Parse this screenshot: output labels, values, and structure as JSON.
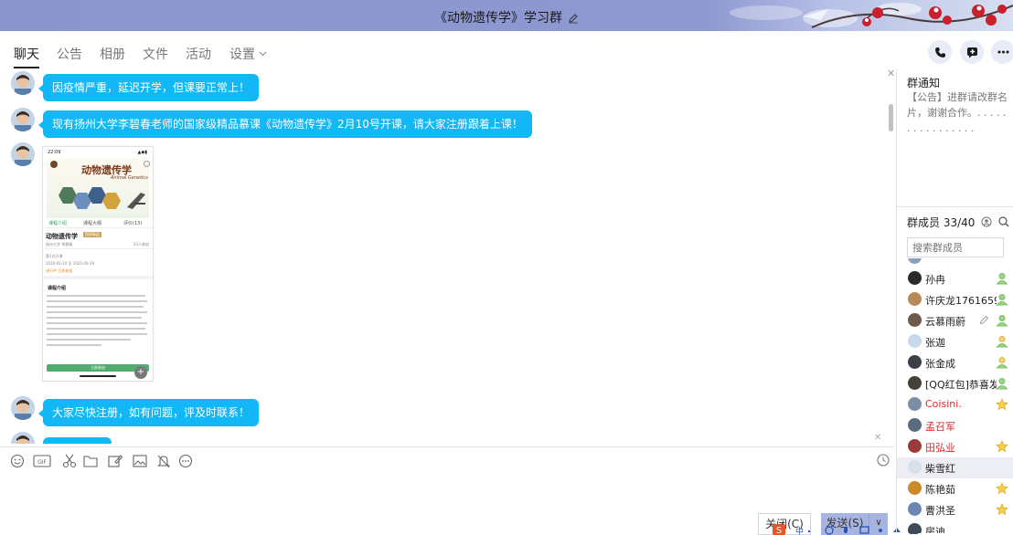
{
  "window": {
    "title": "《动物遗传学》学习群",
    "edit_icon": "pencil-icon"
  },
  "tabs": [
    {
      "label": "聊天",
      "active": true
    },
    {
      "label": "公告"
    },
    {
      "label": "相册"
    },
    {
      "label": "文件"
    },
    {
      "label": "活动"
    },
    {
      "label": "设置"
    }
  ],
  "header_actions": [
    "phone-icon",
    "add-app-icon",
    "more-icon"
  ],
  "messages": [
    {
      "text": "因疫情严重，延迟开学，但课要正常上！"
    },
    {
      "text": "现有扬州大学李碧春老师的国家级精品慕课《动物遗传学》2月10号开课，请大家注册跟着上课！"
    },
    {
      "image": {
        "status_time": "22:09",
        "course_title": "动物遗传学",
        "course_subtitle": "Animal Genetics",
        "tabs": [
          "课程介绍",
          "课程大纲",
          "评价(13)"
        ],
        "name": "动物遗传学",
        "badge": "国家精品",
        "school": "扬州大学 李碧春",
        "enrolled": "33人参加",
        "term": "第1次开课",
        "dates": "2020-02-10 至 2020-06-29",
        "status": "进行中 立即参加",
        "section": "课程介绍",
        "button": "立即参加"
      }
    },
    {
      "text": "大家尽快注册，如有问题，评及时联系！"
    }
  ],
  "input_toolbar": [
    "emoji-icon",
    "gif-icon",
    "scissors-icon",
    "folder-icon",
    "image-edit-icon",
    "picture-icon",
    "bell-icon",
    "more-circle-icon"
  ],
  "buttons": {
    "close": "关闭(C)",
    "send": "发送(S)"
  },
  "notice": {
    "title": "群通知",
    "text": "【公告】进群请改群名片，谢谢合作。. . . . . . . . . . . . . . . ."
  },
  "members": {
    "title": "群成员 33/40",
    "search_placeholder": "搜索群成员",
    "list": [
      {
        "name": "孙冉",
        "role": "admin",
        "color": "#222"
      },
      {
        "name": "许庆龙1761659",
        "role": "admin",
        "color": "#222"
      },
      {
        "name": "云慕雨蔚",
        "role": "admin",
        "editable": true,
        "color": "#222"
      },
      {
        "name": "张迦",
        "role": "admin",
        "color": "#222"
      },
      {
        "name": "张金成",
        "role": "admin",
        "color": "#222"
      },
      {
        "name": "[QQ红包]恭喜发",
        "role": "admin",
        "color": "#222"
      },
      {
        "name": "Coisini.",
        "role": "owner",
        "color": "#e0272b"
      },
      {
        "name": "孟召军",
        "role": "",
        "color": "#e0272b"
      },
      {
        "name": "田弘业",
        "role": "owner",
        "color": "#e0272b"
      },
      {
        "name": "柴雪红",
        "role": "",
        "selected": true,
        "color": "#222"
      },
      {
        "name": "陈艳茹",
        "role": "owner",
        "color": "#222"
      },
      {
        "name": "曹洪圣",
        "role": "owner",
        "color": "#222"
      },
      {
        "name": "房迪",
        "role": "",
        "color": "#222"
      }
    ]
  }
}
